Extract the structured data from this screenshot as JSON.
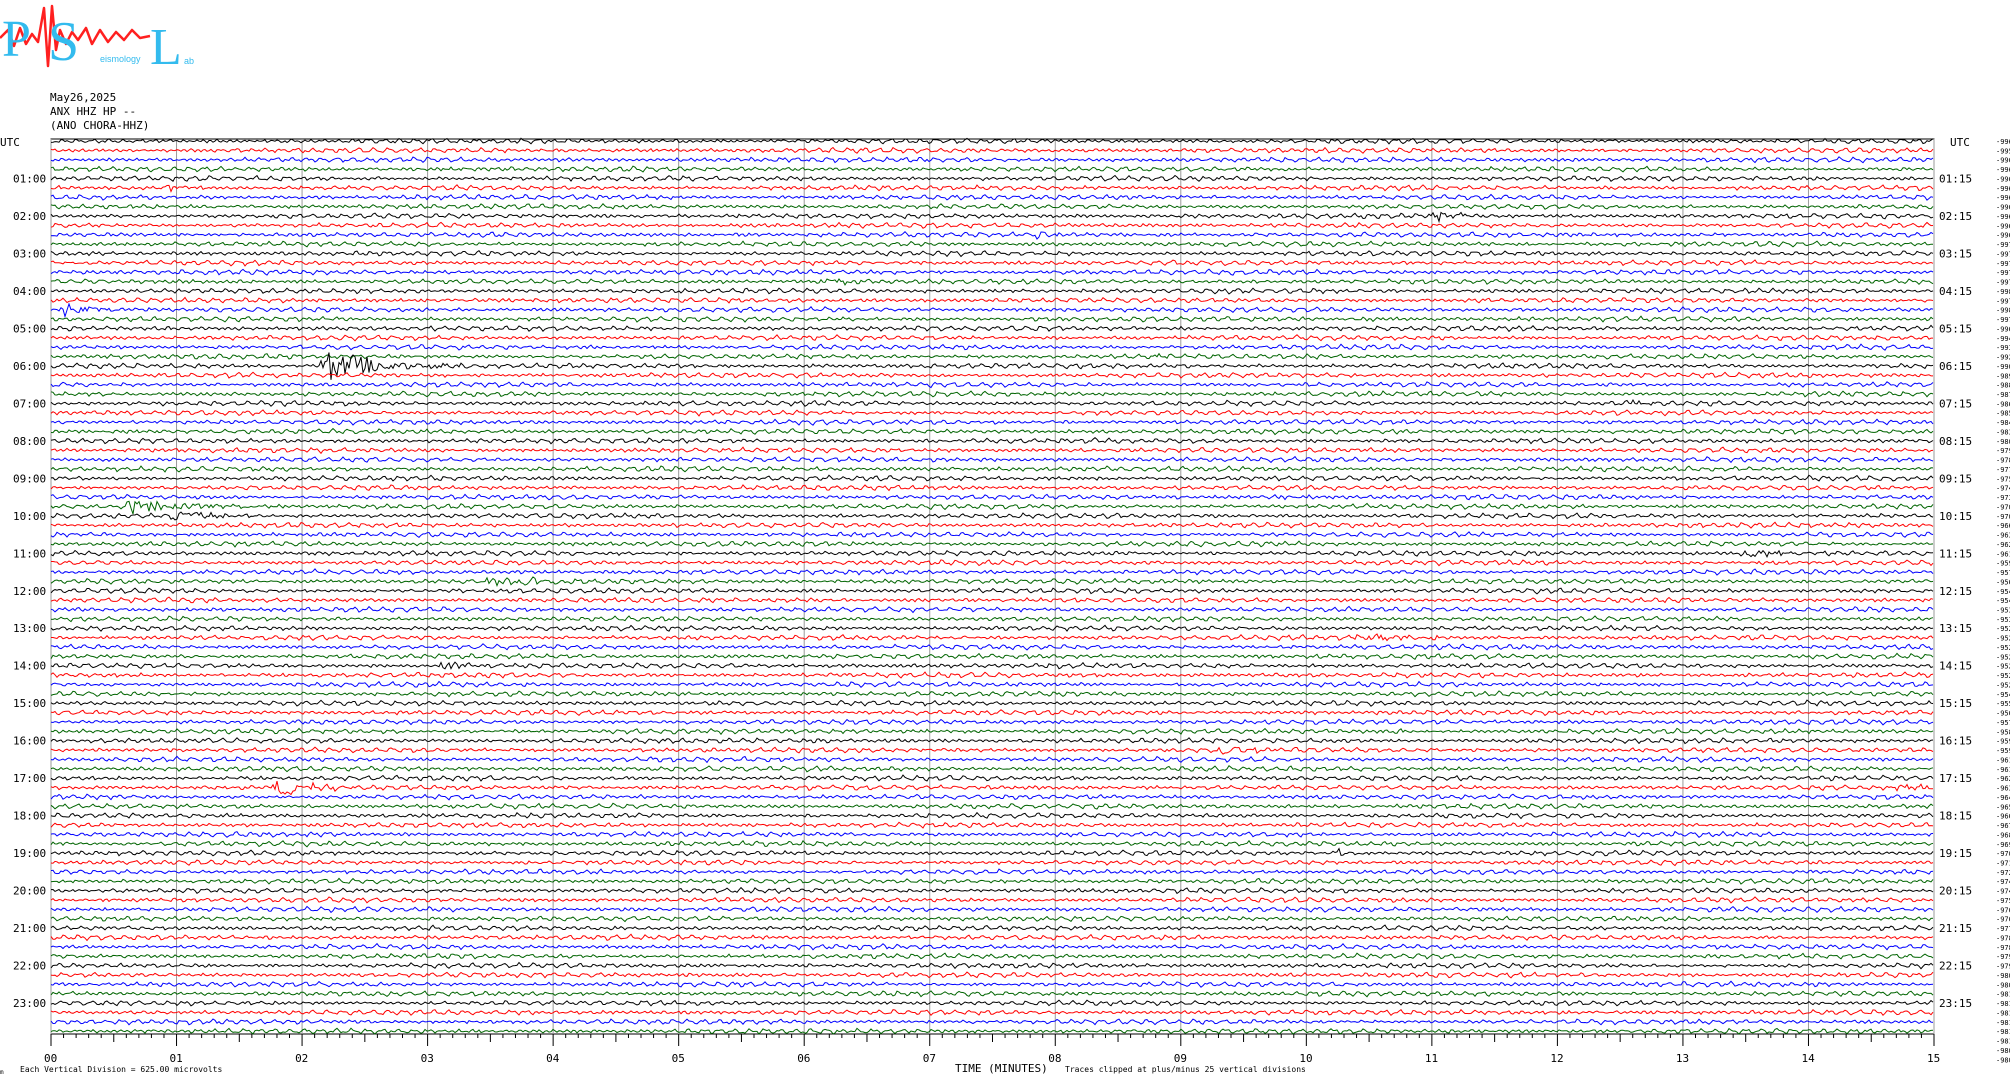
{
  "logo": {
    "letters": [
      "P",
      "S",
      "L"
    ],
    "caption": "eismology",
    "caption_end": "ab"
  },
  "header": {
    "date": "May26,2025",
    "station": "ANX HHZ HP --",
    "channel": "(ANO CHORA-HHZ)"
  },
  "chart_data": {
    "type": "helicorder",
    "ylabel_left": "UTC",
    "ylabel_right": "UTC",
    "xlabel": "TIME (MINUTES)",
    "xlim": [
      0,
      15
    ],
    "x_ticks": [
      "00",
      "01",
      "02",
      "03",
      "04",
      "05",
      "06",
      "07",
      "08",
      "09",
      "10",
      "11",
      "12",
      "13",
      "14",
      "15"
    ],
    "left_hour_labels": [
      "01:00",
      "02:00",
      "03:00",
      "04:00",
      "05:00",
      "06:00",
      "07:00",
      "08:00",
      "09:00",
      "10:00",
      "11:00",
      "12:00",
      "13:00",
      "14:00",
      "15:00",
      "16:00",
      "17:00",
      "18:00",
      "19:00",
      "20:00",
      "21:00",
      "22:00",
      "23:00"
    ],
    "right_hour_labels": [
      "01:15",
      "02:15",
      "03:15",
      "04:15",
      "05:15",
      "06:15",
      "07:15",
      "08:15",
      "09:15",
      "10:15",
      "11:15",
      "12:15",
      "13:15",
      "14:15",
      "15:15",
      "16:15",
      "17:15",
      "18:15",
      "19:15",
      "20:15",
      "21:15",
      "22:15",
      "23:15"
    ],
    "trace_colors": [
      "#000000",
      "#ff0000",
      "#0000ff",
      "#006400"
    ],
    "row_count": 96,
    "row_offsets": [
      -9969,
      -9956,
      -9960,
      -9964,
      -9961,
      -9965,
      -9960,
      -9960,
      -9968,
      -9969,
      -9969,
      -9973,
      -9979,
      -9977,
      -9979,
      -9977,
      -9980,
      -9975,
      -9987,
      -9973,
      -9960,
      -9945,
      -9935,
      -9924,
      -9905,
      -9896,
      -9883,
      -9871,
      -9862,
      -9856,
      -9844,
      -9834,
      -9809,
      -9795,
      -9787,
      -9773,
      -9757,
      -9742,
      -9732,
      -9707,
      -9708,
      -9660,
      -9639,
      -9628,
      -9614,
      -9599,
      -9579,
      -9562,
      -9549,
      -9540,
      -9530,
      -9535,
      -9524,
      -9526,
      -9522,
      -9525,
      -9521,
      -9529,
      -9525,
      -9545,
      -9555,
      -9567,
      -9576,
      -9581,
      -9591,
      -9597,
      -9611,
      -9617,
      -9621,
      -9630,
      -9644,
      -9654,
      -9661,
      -9677,
      -9687,
      -9696,
      -9709,
      -9713,
      -9726,
      -9740,
      -9749,
      -9753,
      -9761,
      -9765,
      -9776,
      -9786,
      -9787,
      -9793,
      -9795,
      -9800,
      -9806,
      -9811,
      -9814,
      -9815,
      -9812,
      -9816,
      -9811,
      -9806,
      -9806
    ],
    "events": [
      {
        "row": 5,
        "minute": 0.9,
        "amp": 1.8,
        "dur": 0.6
      },
      {
        "row": 10,
        "minute": 7.85,
        "amp": 2.2,
        "dur": 0.4
      },
      {
        "row": 8,
        "minute": 11.05,
        "amp": 2.5,
        "dur": 0.7
      },
      {
        "row": 15,
        "minute": 6.1,
        "amp": 2.2,
        "dur": 0.8
      },
      {
        "row": 18,
        "minute": 0.1,
        "amp": 3.5,
        "dur": 0.6
      },
      {
        "row": 19,
        "minute": 10.4,
        "amp": 1.5,
        "dur": 0.3
      },
      {
        "row": 23,
        "minute": 8.8,
        "amp": 2.2,
        "dur": 0.3
      },
      {
        "row": 24,
        "minute": 2.2,
        "amp": 8.0,
        "dur": 1.3
      },
      {
        "row": 28,
        "minute": 12.6,
        "amp": 2.0,
        "dur": 0.4
      },
      {
        "row": 38,
        "minute": 9.7,
        "amp": 1.6,
        "dur": 0.5
      },
      {
        "row": 39,
        "minute": 0.6,
        "amp": 3.2,
        "dur": 1.6
      },
      {
        "row": 40,
        "minute": 1.0,
        "amp": 4.0,
        "dur": 0.7
      },
      {
        "row": 44,
        "minute": 13.5,
        "amp": 2.0,
        "dur": 1.2
      },
      {
        "row": 47,
        "minute": 3.5,
        "amp": 2.4,
        "dur": 1.2
      },
      {
        "row": 53,
        "minute": 10.4,
        "amp": 1.8,
        "dur": 1.6
      },
      {
        "row": 56,
        "minute": 3.1,
        "amp": 1.8,
        "dur": 0.6
      },
      {
        "row": 63,
        "minute": 10.7,
        "amp": 1.4,
        "dur": 0.2
      },
      {
        "row": 65,
        "minute": 9.3,
        "amp": 2.5,
        "dur": 1.0
      },
      {
        "row": 69,
        "minute": 1.8,
        "amp": 4.5,
        "dur": 0.8
      },
      {
        "row": 69,
        "minute": 14.7,
        "amp": 2.0,
        "dur": 0.9
      },
      {
        "row": 76,
        "minute": 10.25,
        "amp": 2.0,
        "dur": 0.4
      }
    ]
  },
  "footer": {
    "division": "Each Vertical Division =  625.00 microvolts",
    "clipped": "Traces clipped at plus/minus 25 vertical divisions",
    "corner": "m"
  }
}
